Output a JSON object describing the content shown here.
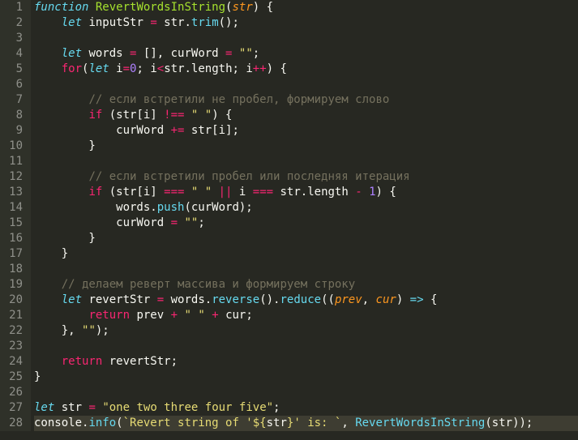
{
  "lines": {
    "1": {
      "t": [
        {
          "c": "k-storage",
          "v": "function"
        },
        {
          "c": "k-punc",
          "v": " "
        },
        {
          "c": "k-name",
          "v": "RevertWordsInString"
        },
        {
          "c": "k-punc",
          "v": "("
        },
        {
          "c": "k-param",
          "v": "str"
        },
        {
          "c": "k-punc",
          "v": ") {"
        }
      ]
    },
    "2": {
      "t": [
        {
          "c": "k-punc",
          "v": "    "
        },
        {
          "c": "k-storage",
          "v": "let"
        },
        {
          "c": "k-punc",
          "v": " inputStr "
        },
        {
          "c": "k-op",
          "v": "="
        },
        {
          "c": "k-punc",
          "v": " str."
        },
        {
          "c": "k-func",
          "v": "trim"
        },
        {
          "c": "k-punc",
          "v": "();"
        }
      ]
    },
    "3": {
      "t": [
        {
          "c": "k-punc",
          "v": ""
        }
      ]
    },
    "4": {
      "t": [
        {
          "c": "k-punc",
          "v": "    "
        },
        {
          "c": "k-storage",
          "v": "let"
        },
        {
          "c": "k-punc",
          "v": " words "
        },
        {
          "c": "k-op",
          "v": "="
        },
        {
          "c": "k-punc",
          "v": " [], curWord "
        },
        {
          "c": "k-op",
          "v": "="
        },
        {
          "c": "k-punc",
          "v": " "
        },
        {
          "c": "k-str",
          "v": "\"\""
        },
        {
          "c": "k-punc",
          "v": ";"
        }
      ]
    },
    "5": {
      "t": [
        {
          "c": "k-punc",
          "v": "    "
        },
        {
          "c": "k-kw",
          "v": "for"
        },
        {
          "c": "k-punc",
          "v": "("
        },
        {
          "c": "k-storage",
          "v": "let"
        },
        {
          "c": "k-punc",
          "v": " i"
        },
        {
          "c": "k-op",
          "v": "="
        },
        {
          "c": "k-num",
          "v": "0"
        },
        {
          "c": "k-punc",
          "v": "; i"
        },
        {
          "c": "k-op",
          "v": "<"
        },
        {
          "c": "k-punc",
          "v": "str.length; i"
        },
        {
          "c": "k-op",
          "v": "++"
        },
        {
          "c": "k-punc",
          "v": ") {"
        }
      ]
    },
    "6": {
      "t": [
        {
          "c": "k-punc",
          "v": ""
        }
      ]
    },
    "7": {
      "t": [
        {
          "c": "k-punc",
          "v": "        "
        },
        {
          "c": "k-comment",
          "v": "// если встретили не пробел, формируем слово"
        }
      ]
    },
    "8": {
      "t": [
        {
          "c": "k-punc",
          "v": "        "
        },
        {
          "c": "k-kw",
          "v": "if"
        },
        {
          "c": "k-punc",
          "v": " (str[i] "
        },
        {
          "c": "k-op",
          "v": "!=="
        },
        {
          "c": "k-punc",
          "v": " "
        },
        {
          "c": "k-str",
          "v": "\" \""
        },
        {
          "c": "k-punc",
          "v": ") {"
        }
      ]
    },
    "9": {
      "t": [
        {
          "c": "k-punc",
          "v": "            curWord "
        },
        {
          "c": "k-op",
          "v": "+="
        },
        {
          "c": "k-punc",
          "v": " str[i];"
        }
      ]
    },
    "10": {
      "t": [
        {
          "c": "k-punc",
          "v": "        }"
        }
      ]
    },
    "11": {
      "t": [
        {
          "c": "k-punc",
          "v": ""
        }
      ]
    },
    "12": {
      "t": [
        {
          "c": "k-punc",
          "v": "        "
        },
        {
          "c": "k-comment",
          "v": "// если встретили пробел или последняя итерация"
        }
      ]
    },
    "13": {
      "t": [
        {
          "c": "k-punc",
          "v": "        "
        },
        {
          "c": "k-kw",
          "v": "if"
        },
        {
          "c": "k-punc",
          "v": " (str[i] "
        },
        {
          "c": "k-op",
          "v": "==="
        },
        {
          "c": "k-punc",
          "v": " "
        },
        {
          "c": "k-str",
          "v": "\" \""
        },
        {
          "c": "k-punc",
          "v": " "
        },
        {
          "c": "k-op",
          "v": "||"
        },
        {
          "c": "k-punc",
          "v": " i "
        },
        {
          "c": "k-op",
          "v": "==="
        },
        {
          "c": "k-punc",
          "v": " str.length "
        },
        {
          "c": "k-op",
          "v": "-"
        },
        {
          "c": "k-punc",
          "v": " "
        },
        {
          "c": "k-num",
          "v": "1"
        },
        {
          "c": "k-punc",
          "v": ") {"
        }
      ]
    },
    "14": {
      "t": [
        {
          "c": "k-punc",
          "v": "            words."
        },
        {
          "c": "k-func",
          "v": "push"
        },
        {
          "c": "k-punc",
          "v": "(curWord);"
        }
      ]
    },
    "15": {
      "t": [
        {
          "c": "k-punc",
          "v": "            curWord "
        },
        {
          "c": "k-op",
          "v": "="
        },
        {
          "c": "k-punc",
          "v": " "
        },
        {
          "c": "k-str",
          "v": "\"\""
        },
        {
          "c": "k-punc",
          "v": ";"
        }
      ]
    },
    "16": {
      "t": [
        {
          "c": "k-punc",
          "v": "        }"
        }
      ]
    },
    "17": {
      "t": [
        {
          "c": "k-punc",
          "v": "    }"
        }
      ]
    },
    "18": {
      "t": [
        {
          "c": "k-punc",
          "v": ""
        }
      ]
    },
    "19": {
      "t": [
        {
          "c": "k-punc",
          "v": "    "
        },
        {
          "c": "k-comment",
          "v": "// делаем реверт массива и формируем строку"
        }
      ]
    },
    "20": {
      "t": [
        {
          "c": "k-punc",
          "v": "    "
        },
        {
          "c": "k-storage",
          "v": "let"
        },
        {
          "c": "k-punc",
          "v": " revertStr "
        },
        {
          "c": "k-op",
          "v": "="
        },
        {
          "c": "k-punc",
          "v": " words."
        },
        {
          "c": "k-func",
          "v": "reverse"
        },
        {
          "c": "k-punc",
          "v": "()."
        },
        {
          "c": "k-func",
          "v": "reduce"
        },
        {
          "c": "k-punc",
          "v": "(("
        },
        {
          "c": "k-prev",
          "v": "prev"
        },
        {
          "c": "k-punc",
          "v": ", "
        },
        {
          "c": "k-prev",
          "v": "cur"
        },
        {
          "c": "k-punc",
          "v": ") "
        },
        {
          "c": "k-storage",
          "v": "=>"
        },
        {
          "c": "k-punc",
          "v": " {"
        }
      ]
    },
    "21": {
      "t": [
        {
          "c": "k-punc",
          "v": "        "
        },
        {
          "c": "k-kw",
          "v": "return"
        },
        {
          "c": "k-punc",
          "v": " prev "
        },
        {
          "c": "k-op",
          "v": "+"
        },
        {
          "c": "k-punc",
          "v": " "
        },
        {
          "c": "k-str",
          "v": "\" \""
        },
        {
          "c": "k-punc",
          "v": " "
        },
        {
          "c": "k-op",
          "v": "+"
        },
        {
          "c": "k-punc",
          "v": " cur;"
        }
      ]
    },
    "22": {
      "t": [
        {
          "c": "k-punc",
          "v": "    }, "
        },
        {
          "c": "k-str",
          "v": "\"\""
        },
        {
          "c": "k-punc",
          "v": ");"
        }
      ]
    },
    "23": {
      "t": [
        {
          "c": "k-punc",
          "v": ""
        }
      ]
    },
    "24": {
      "t": [
        {
          "c": "k-punc",
          "v": "    "
        },
        {
          "c": "k-kw",
          "v": "return"
        },
        {
          "c": "k-punc",
          "v": " revertStr;"
        }
      ]
    },
    "25": {
      "t": [
        {
          "c": "k-punc",
          "v": "}"
        }
      ]
    },
    "26": {
      "t": [
        {
          "c": "k-punc",
          "v": ""
        }
      ]
    },
    "27": {
      "t": [
        {
          "c": "k-storage",
          "v": "let"
        },
        {
          "c": "k-punc",
          "v": " str "
        },
        {
          "c": "k-op",
          "v": "="
        },
        {
          "c": "k-punc",
          "v": " "
        },
        {
          "c": "k-str",
          "v": "\"one two three four five\""
        },
        {
          "c": "k-punc",
          "v": ";"
        }
      ]
    },
    "28": {
      "t": [
        {
          "c": "k-punc",
          "v": "console."
        },
        {
          "c": "k-func",
          "v": "info"
        },
        {
          "c": "k-punc",
          "v": "("
        },
        {
          "c": "k-str",
          "v": "`Revert string of '${"
        },
        {
          "c": "k-punc",
          "v": "str"
        },
        {
          "c": "k-str",
          "v": "}' is: `"
        },
        {
          "c": "k-punc",
          "v": ", "
        },
        {
          "c": "k-func",
          "v": "RevertWordsInString"
        },
        {
          "c": "k-punc",
          "v": "(str));"
        }
      ]
    }
  },
  "lineCount": 28,
  "highlightedLine": 28
}
